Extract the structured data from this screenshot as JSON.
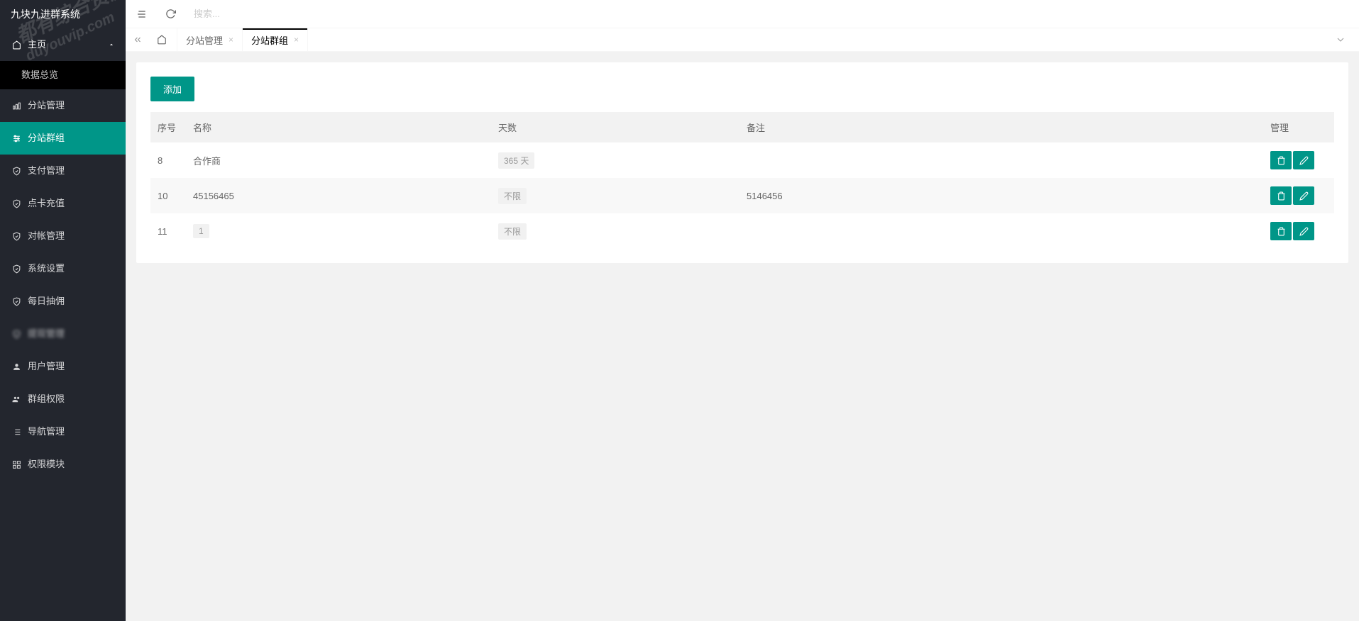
{
  "app": {
    "title": "九块九进群系统",
    "search_placeholder": "搜索..."
  },
  "watermark": {
    "line1": "都有综合资源网",
    "line2": "duyouvip.com"
  },
  "sidebar": {
    "main_label": "主页",
    "sub_label": "数据总览",
    "items": [
      {
        "label": "分站管理",
        "icon": "bar-chart"
      },
      {
        "label": "分站群组",
        "icon": "sliders",
        "active": true
      },
      {
        "label": "支付管理",
        "icon": "shield"
      },
      {
        "label": "点卡充值",
        "icon": "shield"
      },
      {
        "label": "对帐管理",
        "icon": "shield"
      },
      {
        "label": "系统设置",
        "icon": "shield"
      },
      {
        "label": "每日抽佣",
        "icon": "shield"
      },
      {
        "label": "提现管理",
        "icon": "shield",
        "blur": true
      },
      {
        "label": "用户管理",
        "icon": "user"
      },
      {
        "label": "群组权限",
        "icon": "users"
      },
      {
        "label": "导航管理",
        "icon": "list"
      },
      {
        "label": "权限模块",
        "icon": "grid"
      }
    ]
  },
  "tabs": [
    {
      "label": "分站管理",
      "active": false
    },
    {
      "label": "分站群组",
      "active": true
    }
  ],
  "content": {
    "add_button": "添加",
    "columns": {
      "seq": "序号",
      "name": "名称",
      "days": "天数",
      "note": "备注",
      "manage": "管理"
    },
    "rows": [
      {
        "seq": "8",
        "name": "合作商",
        "days": "365 天",
        "note": ""
      },
      {
        "seq": "10",
        "name": "45156465",
        "days": "不限",
        "note": "5146456"
      },
      {
        "seq": "11",
        "name": "1",
        "days": "不限",
        "note": "",
        "name_badge": true
      }
    ]
  }
}
